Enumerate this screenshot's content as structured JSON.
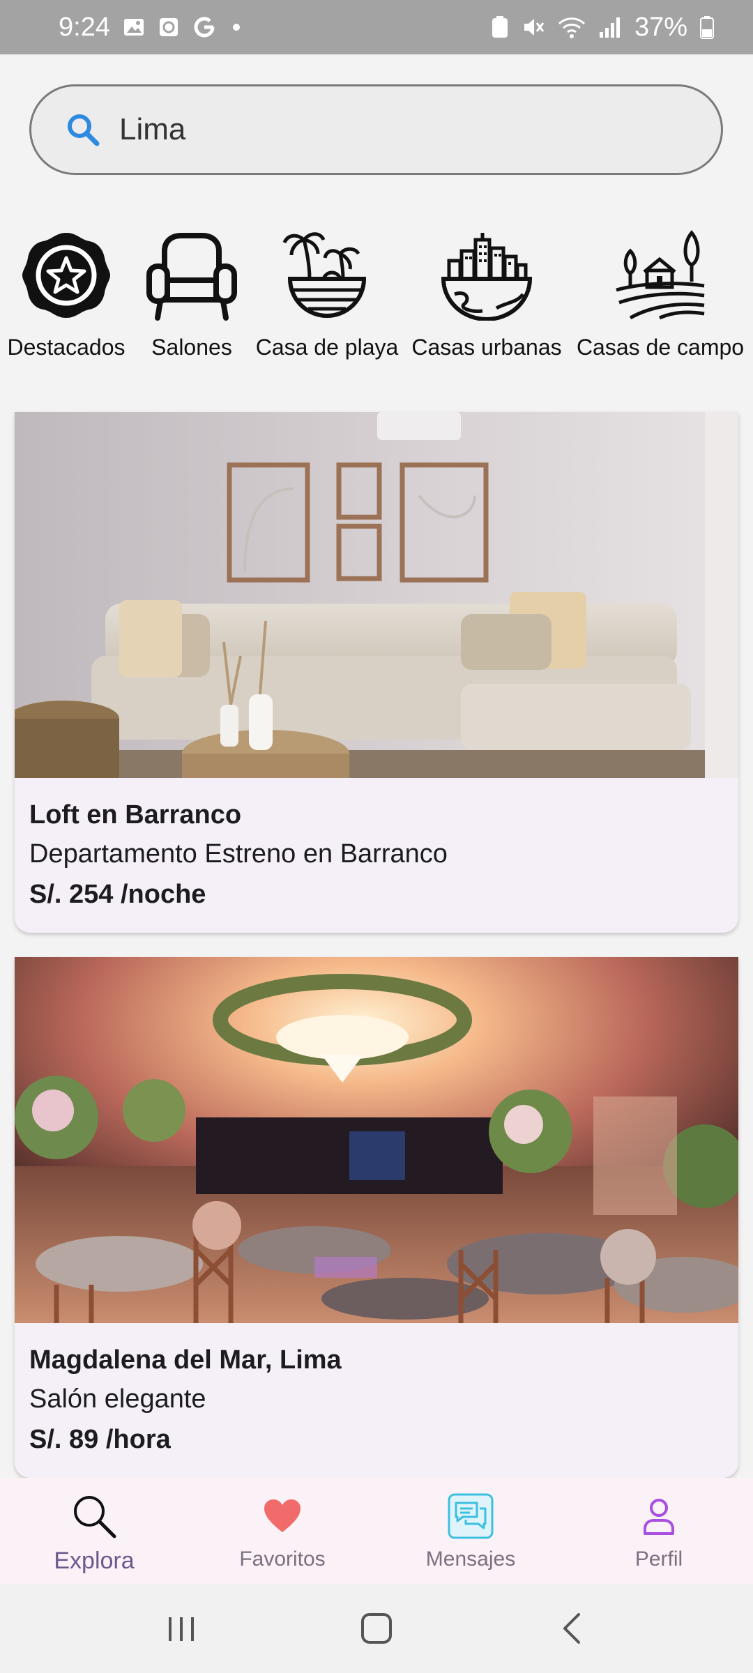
{
  "status": {
    "time": "9:24",
    "battery": "37%",
    "left_icons": [
      "gallery-icon",
      "screen-record-icon",
      "google-icon",
      "dot-icon"
    ],
    "right_icons": [
      "nfc-icon",
      "mute-icon",
      "wifi-icon",
      "signal-icon",
      "battery-icon"
    ]
  },
  "search": {
    "value": "Lima",
    "icon": "search-icon",
    "accent": "#2d8ae0"
  },
  "categories": [
    {
      "label": "Destacados",
      "icon": "star-badge-icon"
    },
    {
      "label": "Salones",
      "icon": "armchair-icon"
    },
    {
      "label": "Casa de playa",
      "icon": "palm-beach-icon"
    },
    {
      "label": "Casas urbanas",
      "icon": "city-buildings-icon"
    },
    {
      "label": "Casas de campo",
      "icon": "countryside-house-icon"
    }
  ],
  "listings": [
    {
      "title": "Loft en Barranco",
      "subtitle": "Departamento Estreno en Barranco",
      "price": "S/. 254 /noche",
      "image": "living-room-photo"
    },
    {
      "title": "Magdalena del Mar, Lima",
      "subtitle": "Salón elegante",
      "price": "S/. 89 /hora",
      "image": "event-hall-photo"
    }
  ],
  "bottom_nav": [
    {
      "label": "Explora",
      "icon": "search-icon",
      "active": true
    },
    {
      "label": "Favoritos",
      "icon": "heart-icon",
      "color": "#f26b6b"
    },
    {
      "label": "Mensajes",
      "icon": "chat-icon",
      "color": "#3dbfe0"
    },
    {
      "label": "Perfil",
      "icon": "person-icon",
      "color": "#a94fe0"
    }
  ],
  "system_nav": [
    "recents-icon",
    "home-icon",
    "back-icon"
  ]
}
